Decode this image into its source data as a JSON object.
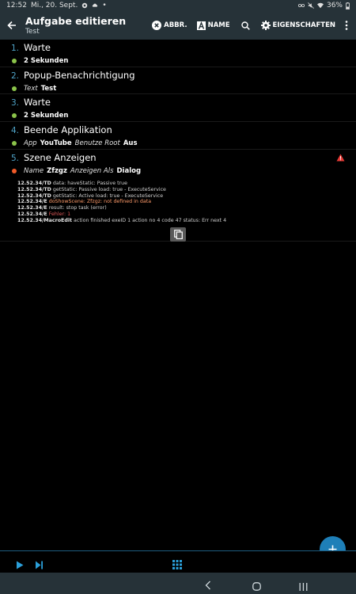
{
  "statusbar": {
    "time": "12:52",
    "date": "Mi., 20. Sept.",
    "battery": "36%"
  },
  "appbar": {
    "title": "Aufgabe editieren",
    "subtitle": "Test",
    "actions": {
      "cancel": "ABBR.",
      "name": "NAME",
      "properties": "EIGENSCHAFTEN"
    }
  },
  "actions": [
    {
      "num": "1.",
      "name": "Warte",
      "params": [
        {
          "key": "",
          "value": "2 Sekunden"
        }
      ]
    },
    {
      "num": "2.",
      "name": "Popup-Benachrichtigung",
      "params": [
        {
          "key": "Text",
          "value": "Test"
        }
      ]
    },
    {
      "num": "3.",
      "name": "Warte",
      "params": [
        {
          "key": "",
          "value": "2 Sekunden"
        }
      ]
    },
    {
      "num": "4.",
      "name": "Beende Applikation",
      "params": [
        {
          "key": "App",
          "value": "YouTube"
        },
        {
          "key": "Benutze Root",
          "value": "Aus"
        }
      ]
    },
    {
      "num": "5.",
      "name": "Szene Anzeigen",
      "params": [
        {
          "key": "Name",
          "value": "Zfzgz"
        },
        {
          "key": "Anzeigen Als",
          "value": "Dialog"
        }
      ],
      "log": [
        {
          "ts": "12.52.34/TD",
          "msg": "data: haveStatic: Passive true",
          "color": "normal"
        },
        {
          "ts": "12.52.34/TD",
          "msg": "getStatic: Passive load: true - ExecuteService",
          "color": "normal"
        },
        {
          "ts": "12.52.34/TD",
          "msg": "getStatic: Active load: true - ExecuteService",
          "color": "normal"
        },
        {
          "ts": "12.52.34/E",
          "msg": "doShowScene: Zfzgz: not defined in data",
          "color": "orange"
        },
        {
          "ts": "12.52.34/E",
          "msg": "result: stop task (error)",
          "color": "normal"
        },
        {
          "ts": "12.52.34/E",
          "msg": "Fehler: 1",
          "color": "red"
        },
        {
          "ts": "12.52.34/MacroEdit",
          "msg": "action finished exeID 1 action no 4 code 47 status: Err next 4",
          "color": "normal"
        }
      ]
    }
  ],
  "colors": {
    "appbar": "#263238",
    "number": "#4fa3c7",
    "dot_ok": "#8bc34a",
    "dot_error": "#f05a28",
    "fab": "#1e7fb8"
  }
}
